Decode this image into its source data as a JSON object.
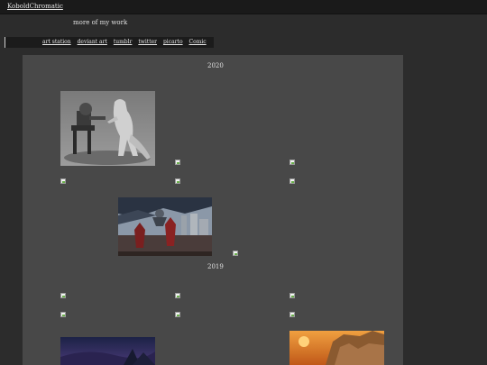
{
  "header": {
    "site_title": "KoboldChromatic"
  },
  "tagline": "more of my work",
  "nav": [
    {
      "label": "art station"
    },
    {
      "label": "deviant art"
    },
    {
      "label": "tumblr"
    },
    {
      "label": "twitter"
    },
    {
      "label": "picarto"
    },
    {
      "label": "Comic"
    }
  ],
  "gallery": {
    "years": [
      "2020",
      "2019"
    ]
  },
  "colors": {
    "page_bg": "#2c2c2c",
    "gallery_bg": "#484848",
    "bar_bg": "#1a1a1a"
  }
}
